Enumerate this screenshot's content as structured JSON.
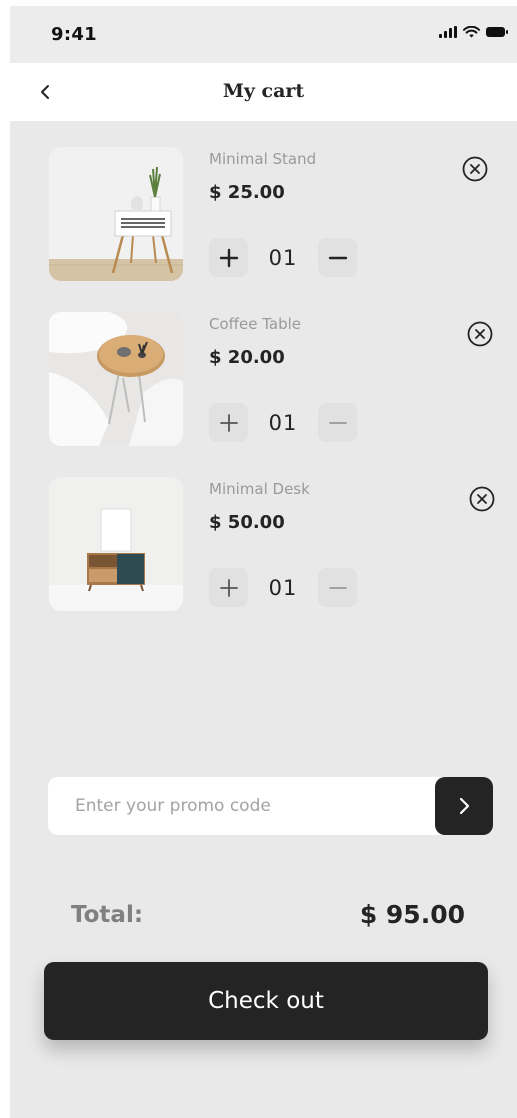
{
  "status_bar": {
    "time": "9:41"
  },
  "header": {
    "title": "My cart"
  },
  "cart": {
    "items": [
      {
        "name": "Minimal Stand",
        "price": "$ 25.00",
        "quantity": "01"
      },
      {
        "name": "Coffee Table",
        "price": "$ 20.00",
        "quantity": "01"
      },
      {
        "name": "Minimal Desk",
        "price": "$ 50.00",
        "quantity": "01"
      }
    ]
  },
  "promo": {
    "placeholder": "Enter your promo code"
  },
  "summary": {
    "total_label": "Total:",
    "total_value": "$ 95.00"
  },
  "checkout": {
    "label": "Check out"
  },
  "colors": {
    "accent": "#242424",
    "background": "#e9e9e9",
    "muted_text": "#9a9a9a"
  }
}
